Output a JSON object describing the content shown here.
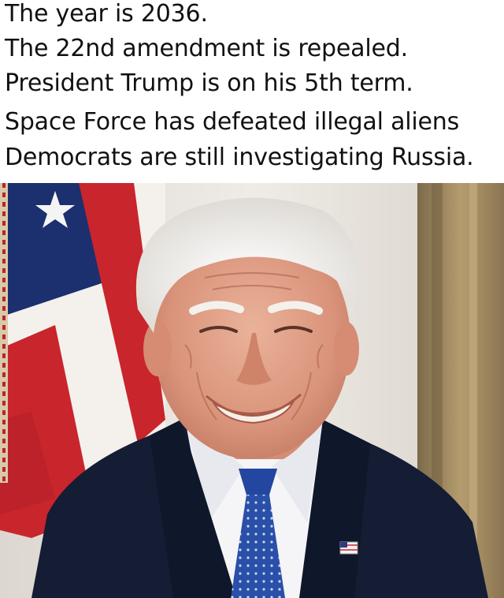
{
  "caption": {
    "lines": [
      "The year is 2036.",
      "The 22nd amendment is repealed.",
      "President Trump is on his 5th term.",
      "Space Force has defeated illegal aliens",
      "Democrats are still investigating Russia."
    ]
  },
  "photo": {
    "colors": {
      "flag_red": "#c9252c",
      "flag_blue": "#1c2f6e",
      "suit": "#141d33",
      "tie": "#2a4fa8",
      "skin": "#e2a289",
      "hair": "#f1eee9",
      "background_wall": "#ece9e4",
      "frame_gold": "#a88e62"
    }
  }
}
